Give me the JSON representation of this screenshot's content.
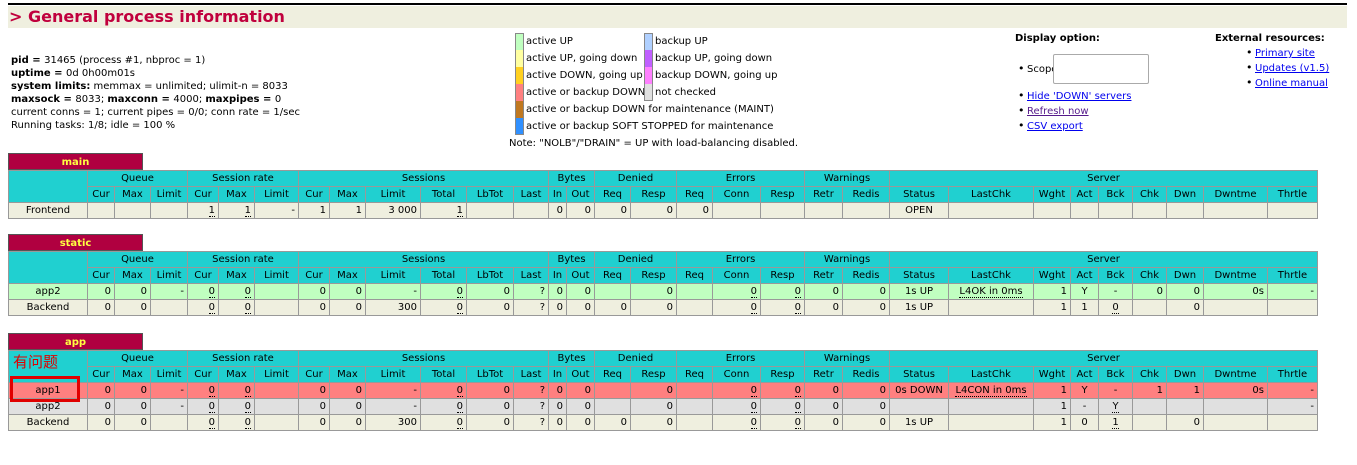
{
  "header": {
    "title": "> General process information"
  },
  "info": {
    "pid_label": "pid = ",
    "pid_value": "31465 (process #1, nbproc = 1)",
    "uptime_label": "uptime = ",
    "uptime_value": "0d 0h00m01s",
    "limits_label": "system limits:",
    "limits_value": " memmax = unlimited; ulimit-n = 8033",
    "maxsock_label": "maxsock = ",
    "maxsock_value": "8033; ",
    "maxconn_label": "maxconn = ",
    "maxconn_value": "4000; ",
    "maxpipes_label": "maxpipes = ",
    "maxpipes_value": "0",
    "conns": "current conns = 1; current pipes = 0/0; conn rate = 1/sec",
    "tasks": "Running tasks: 1/8; idle = 100 %"
  },
  "legend": {
    "left": [
      {
        "label": "active UP",
        "color": "#c0ffc0"
      },
      {
        "label": "active UP, going down",
        "color": "#ffffa0"
      },
      {
        "label": "active DOWN, going up",
        "color": "#ffd020"
      },
      {
        "label": "active or backup DOWN",
        "color": "#ff8080"
      },
      {
        "label": "active or backup DOWN for maintenance (MAINT)",
        "color": "#c07820"
      },
      {
        "label": "active or backup SOFT STOPPED for maintenance",
        "color": "#3090ff"
      }
    ],
    "right": [
      {
        "label": "backup UP",
        "color": "#b0d0ff"
      },
      {
        "label": "backup UP, going down",
        "color": "#c060ff"
      },
      {
        "label": "backup DOWN, going up",
        "color": "#ff80ff"
      },
      {
        "label": "not checked",
        "color": "#e0e0e0"
      }
    ],
    "note": "Note: \"NOLB\"/\"DRAIN\" = UP with load-balancing disabled."
  },
  "display": {
    "title": "Display option:",
    "scope_label": "Scope :",
    "hide_down": "Hide 'DOWN' servers",
    "refresh": "Refresh now",
    "csv": "CSV export"
  },
  "external": {
    "title": "External resources:",
    "primary": "Primary site",
    "updates": "Updates (v1.5)",
    "manual": "Online manual"
  },
  "headers": {
    "groups": [
      "Queue",
      "Session rate",
      "Sessions",
      "Bytes",
      "Denied",
      "Errors",
      "Warnings",
      "Server"
    ],
    "cols": [
      "Cur",
      "Max",
      "Limit",
      "Cur",
      "Max",
      "Limit",
      "Cur",
      "Max",
      "Limit",
      "Total",
      "LbTot",
      "Last",
      "In",
      "Out",
      "Req",
      "Resp",
      "Req",
      "Conn",
      "Resp",
      "Retr",
      "Redis",
      "Status",
      "LastChk",
      "Wght",
      "Act",
      "Bck",
      "Chk",
      "Dwn",
      "Dwntme",
      "Thrtle"
    ]
  },
  "proxies": {
    "main": {
      "name": "main",
      "rows": [
        {
          "name": "Frontend",
          "cells": [
            "",
            "",
            "",
            "1",
            "1",
            "-",
            "1",
            "1",
            "3 000",
            "1",
            "",
            "",
            "0",
            "0",
            "0",
            "0",
            "0",
            "",
            "",
            "",
            "",
            "OPEN",
            "",
            "",
            "",
            "",
            "",
            "",
            "",
            ""
          ]
        }
      ]
    },
    "static": {
      "name": "static",
      "rows": [
        {
          "name": "app2",
          "cells": [
            "0",
            "0",
            "-",
            "0",
            "0",
            "",
            "0",
            "0",
            "-",
            "0",
            "0",
            "?",
            "0",
            "0",
            "",
            "0",
            "",
            "0",
            "0",
            "0",
            "0",
            "1s UP",
            "L4OK in 0ms",
            "1",
            "Y",
            "-",
            "0",
            "0",
            "0s",
            "-"
          ]
        },
        {
          "name": "Backend",
          "cells": [
            "0",
            "0",
            "",
            "0",
            "0",
            "",
            "0",
            "0",
            "300",
            "0",
            "0",
            "?",
            "0",
            "0",
            "0",
            "0",
            "",
            "0",
            "0",
            "0",
            "0",
            "1s UP",
            "",
            "1",
            "1",
            "0",
            "",
            "0",
            "",
            ""
          ]
        }
      ]
    },
    "app": {
      "name": "app",
      "note": "有问题",
      "rows": [
        {
          "name": "app1",
          "cells": [
            "0",
            "0",
            "-",
            "0",
            "0",
            "",
            "0",
            "0",
            "-",
            "0",
            "0",
            "?",
            "0",
            "0",
            "",
            "0",
            "",
            "0",
            "0",
            "0",
            "0",
            "0s DOWN",
            "L4CON in 0ms",
            "1",
            "Y",
            "-",
            "1",
            "1",
            "0s",
            "-"
          ]
        },
        {
          "name": "app2",
          "cells": [
            "0",
            "0",
            "-",
            "0",
            "0",
            "",
            "0",
            "0",
            "-",
            "0",
            "0",
            "?",
            "0",
            "0",
            "",
            "0",
            "",
            "0",
            "0",
            "0",
            "0",
            "",
            "",
            "1",
            "-",
            "Y",
            "",
            "",
            "",
            "-"
          ]
        },
        {
          "name": "Backend",
          "cells": [
            "0",
            "0",
            "",
            "0",
            "0",
            "",
            "0",
            "0",
            "300",
            "0",
            "0",
            "?",
            "0",
            "0",
            "0",
            "0",
            "",
            "0",
            "0",
            "0",
            "0",
            "1s UP",
            "",
            "1",
            "0",
            "1",
            "",
            "0",
            "",
            ""
          ]
        }
      ]
    }
  }
}
